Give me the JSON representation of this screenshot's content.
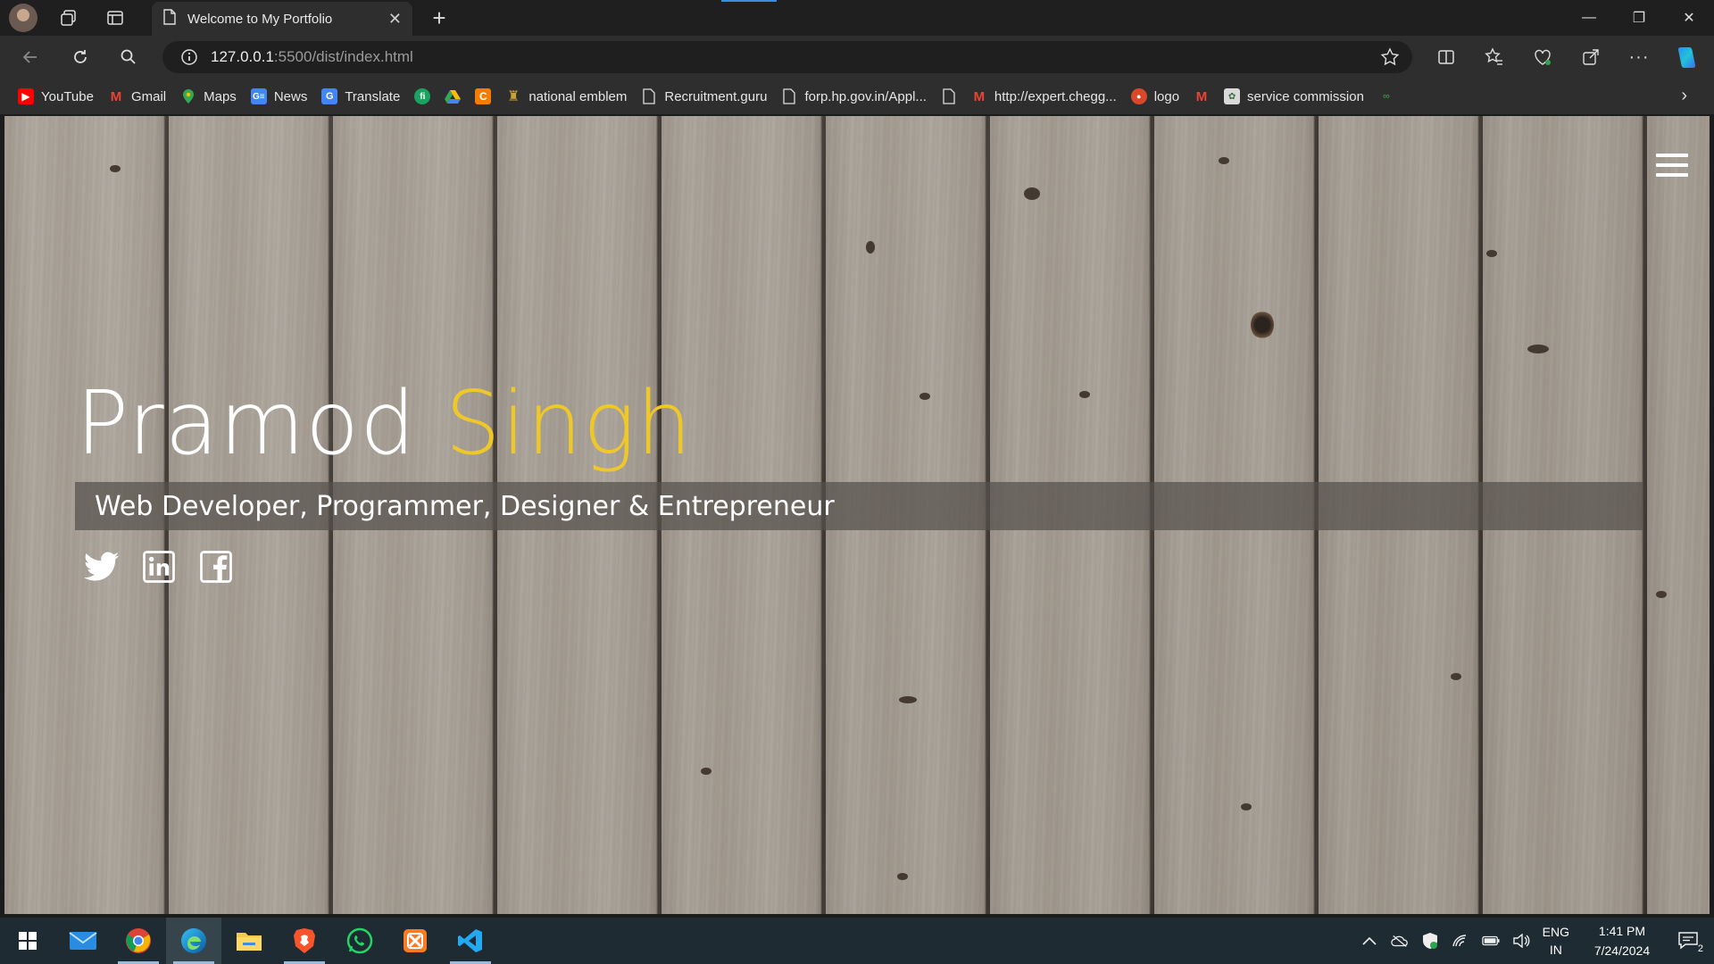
{
  "browser": {
    "tab": {
      "title": "Welcome to My Portfolio"
    },
    "address": {
      "host": "127.0.0.1",
      "path": ":5500/dist/index.html"
    },
    "bookmarks": [
      {
        "label": "YouTube",
        "icon": "youtube-icon",
        "color": "#ff0000"
      },
      {
        "label": "Gmail",
        "icon": "gmail-icon",
        "color": "#ea4335"
      },
      {
        "label": "Maps",
        "icon": "maps-icon",
        "color": "#34a853"
      },
      {
        "label": "News",
        "icon": "news-icon",
        "color": "#4285f4"
      },
      {
        "label": "Translate",
        "icon": "translate-icon",
        "color": "#4285f4"
      },
      {
        "label": "",
        "icon": "fi-icon",
        "color": "#1aa260"
      },
      {
        "label": "",
        "icon": "drive-icon",
        "color": "#fbbc04"
      },
      {
        "label": "",
        "icon": "c-icon",
        "color": "#f57c00"
      },
      {
        "label": "national emblem",
        "icon": "emblem-icon",
        "color": "#c8a13a"
      },
      {
        "label": "Recruitment.guru",
        "icon": "page-icon",
        "color": ""
      },
      {
        "label": "forp.hp.gov.in/Appl...",
        "icon": "page-icon",
        "color": ""
      },
      {
        "label": "",
        "icon": "page-icon",
        "color": ""
      },
      {
        "label": "http://expert.chegg...",
        "icon": "gmail-icon",
        "color": "#ea4335"
      },
      {
        "label": "logo",
        "icon": "logo-icon",
        "color": "#d9482b"
      },
      {
        "label": "",
        "icon": "gmail-icon",
        "color": "#ea4335"
      },
      {
        "label": "service commission",
        "icon": "commission-icon",
        "color": "#7a8a7a"
      },
      {
        "label": "",
        "icon": "ge-icon",
        "color": "#3b8a3b"
      }
    ]
  },
  "hero": {
    "first_name": "Pramod",
    "last_name": "Singh",
    "tagline": "Web Developer, Programmer, Designer & Entrepreneur",
    "accent_color": "#eec82a",
    "social": [
      "twitter-icon",
      "linkedin-icon",
      "facebook-icon"
    ]
  },
  "taskbar": {
    "apps": [
      "start-icon",
      "mail-icon",
      "chrome-icon",
      "edge-icon",
      "file-explorer-icon",
      "brave-icon",
      "whatsapp-icon",
      "xampp-icon",
      "vscode-icon"
    ],
    "lang_top": "ENG",
    "lang_bottom": "IN",
    "time": "1:41 PM",
    "date": "7/24/2024",
    "notifications": "2"
  }
}
